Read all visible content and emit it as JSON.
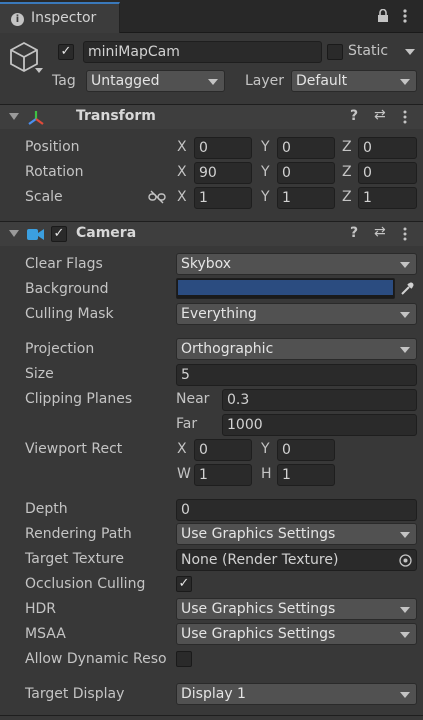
{
  "tab": {
    "title": "Inspector",
    "icon": "info-icon"
  },
  "window_icons": [
    "lock-icon",
    "more-icon"
  ],
  "object": {
    "enabled": true,
    "name": "miniMapCam",
    "static_label": "Static",
    "static_checked": false,
    "tag_label": "Tag",
    "tag_value": "Untagged",
    "layer_label": "Layer",
    "layer_value": "Default"
  },
  "transform": {
    "title": "Transform",
    "position": {
      "label": "Position",
      "x": "0",
      "y": "0",
      "z": "0"
    },
    "rotation": {
      "label": "Rotation",
      "x": "90",
      "y": "0",
      "z": "0"
    },
    "scale": {
      "label": "Scale",
      "x": "1",
      "y": "1",
      "z": "1"
    },
    "axes": {
      "x": "X",
      "y": "Y",
      "z": "Z"
    }
  },
  "camera": {
    "title": "Camera",
    "enabled": true,
    "clear_flags": {
      "label": "Clear Flags",
      "value": "Skybox"
    },
    "background": {
      "label": "Background",
      "color": "#2b4c80"
    },
    "culling_mask": {
      "label": "Culling Mask",
      "value": "Everything"
    },
    "projection": {
      "label": "Projection",
      "value": "Orthographic"
    },
    "size": {
      "label": "Size",
      "value": "5"
    },
    "clipping": {
      "label": "Clipping Planes",
      "near_label": "Near",
      "near": "0.3",
      "far_label": "Far",
      "far": "1000"
    },
    "viewport": {
      "label": "Viewport Rect",
      "x_label": "X",
      "x": "0",
      "y_label": "Y",
      "y": "0",
      "w_label": "W",
      "w": "1",
      "h_label": "H",
      "h": "1"
    },
    "depth": {
      "label": "Depth",
      "value": "0"
    },
    "rendering_path": {
      "label": "Rendering Path",
      "value": "Use Graphics Settings"
    },
    "target_texture": {
      "label": "Target Texture",
      "value": "None (Render Texture)"
    },
    "occlusion": {
      "label": "Occlusion Culling",
      "checked": true
    },
    "hdr": {
      "label": "HDR",
      "value": "Use Graphics Settings"
    },
    "msaa": {
      "label": "MSAA",
      "value": "Use Graphics Settings"
    },
    "dynamic_reso": {
      "label": "Allow Dynamic Reso",
      "checked": false
    },
    "target_display": {
      "label": "Target Display",
      "value": "Display 1"
    }
  },
  "colors": {
    "accent": "#3a79bb",
    "panel": "#383838",
    "field": "#2a2a2a"
  }
}
